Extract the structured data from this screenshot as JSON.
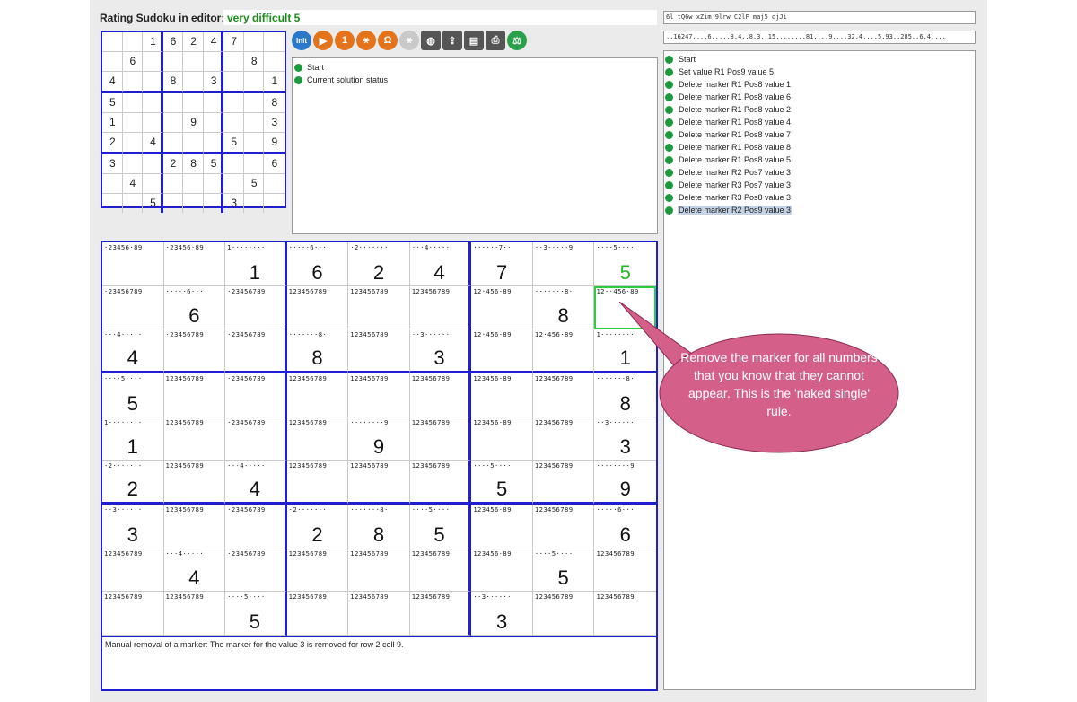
{
  "header": {
    "rating_label": "Rating Sudoku in editor:",
    "rating_value": "very difficult 5",
    "code_line1": "6l tQ6w xZim 9lrw C2lF maj5 qjJi",
    "code_line2": "..16247....6.....8.4..8.3..15........81....9....32.4....5.93..285..6.4...."
  },
  "small_grid": {
    "cells": [
      "",
      "",
      "1",
      "6",
      "2",
      "4",
      "7",
      "",
      "",
      "",
      "6",
      "",
      "",
      "",
      "",
      "",
      "8",
      "",
      "4",
      "",
      "",
      "8",
      "",
      "3",
      "",
      "",
      "1",
      "5",
      "",
      "",
      "",
      "",
      "",
      "",
      "",
      "8",
      "1",
      "",
      "",
      "",
      "9",
      "",
      "",
      "",
      "3",
      "2",
      "",
      "4",
      "",
      "",
      "",
      "5",
      "",
      "9",
      "3",
      "",
      "",
      "2",
      "8",
      "5",
      "",
      "",
      "6",
      "",
      "4",
      "",
      "",
      "",
      "",
      "",
      "5",
      "",
      "",
      "",
      "5",
      "",
      "",
      "",
      "3",
      "",
      ""
    ]
  },
  "toolbar": {
    "buttons": [
      {
        "name": "init-button",
        "label": "Init",
        "style": "init"
      },
      {
        "name": "play-icon",
        "label": "▶",
        "style": "orange"
      },
      {
        "name": "step-one-icon",
        "label": "1",
        "style": "orange"
      },
      {
        "name": "walk-icon",
        "label": "⚹",
        "style": "orange"
      },
      {
        "name": "omega-icon",
        "label": "Ω",
        "style": "orange"
      },
      {
        "name": "runner-disabled-icon",
        "label": "⚹",
        "style": "gray"
      },
      {
        "name": "globe-icon",
        "label": "◍",
        "style": "dark"
      },
      {
        "name": "export-icon",
        "label": "⇪",
        "style": "dark"
      },
      {
        "name": "save-icon",
        "label": "▤",
        "style": "dark"
      },
      {
        "name": "print-icon",
        "label": "⎙",
        "style": "dark"
      },
      {
        "name": "balance-icon",
        "label": "⚖",
        "style": "green"
      }
    ]
  },
  "status": {
    "items": [
      "Start",
      "Current solution status"
    ]
  },
  "history": {
    "items": [
      "Start",
      "Set value R1 Pos9 value 5",
      "Delete marker R1 Pos8 value 1",
      "Delete marker R1 Pos8 value 6",
      "Delete marker R1 Pos8 value 2",
      "Delete marker R1 Pos8 value 4",
      "Delete marker R1 Pos8 value 7",
      "Delete marker R1 Pos8 value 8",
      "Delete marker R1 Pos8 value 5",
      "Delete marker R2 Pos7 value 3",
      "Delete marker R3 Pos7 value 3",
      "Delete marker R3 Pos8 value 3",
      "Delete marker R2 Pos9 value 3"
    ],
    "selected_index": 12
  },
  "big_grid": {
    "cells": [
      {
        "m": "·23456·89",
        "v": ""
      },
      {
        "m": "·23456·89",
        "v": ""
      },
      {
        "m": "1········",
        "v": "1"
      },
      {
        "m": "·····6···",
        "v": "6"
      },
      {
        "m": "·2·······",
        "v": "2"
      },
      {
        "m": "···4·····",
        "v": "4"
      },
      {
        "m": "······7··",
        "v": "7"
      },
      {
        "m": "··3·····9",
        "v": ""
      },
      {
        "m": "····5····",
        "v": "5",
        "green": true
      },
      {
        "m": "·23456789",
        "v": ""
      },
      {
        "m": "·····6···",
        "v": "6"
      },
      {
        "m": "·23456789",
        "v": ""
      },
      {
        "m": "123456789",
        "v": ""
      },
      {
        "m": "123456789",
        "v": ""
      },
      {
        "m": "123456789",
        "v": ""
      },
      {
        "m": "12·456·89",
        "v": ""
      },
      {
        "m": "·······8·",
        "v": "8"
      },
      {
        "m": "12··456·89",
        "v": "",
        "sel": true
      },
      {
        "m": "···4·····",
        "v": "4"
      },
      {
        "m": "·23456789",
        "v": ""
      },
      {
        "m": "·23456789",
        "v": ""
      },
      {
        "m": "·······8·",
        "v": "8"
      },
      {
        "m": "123456789",
        "v": ""
      },
      {
        "m": "··3······",
        "v": "3"
      },
      {
        "m": "12·456·89",
        "v": ""
      },
      {
        "m": "12·456·89",
        "v": ""
      },
      {
        "m": "1········",
        "v": "1"
      },
      {
        "m": "····5····",
        "v": "5"
      },
      {
        "m": "123456789",
        "v": ""
      },
      {
        "m": "·23456789",
        "v": ""
      },
      {
        "m": "123456789",
        "v": ""
      },
      {
        "m": "123456789",
        "v": ""
      },
      {
        "m": "123456789",
        "v": ""
      },
      {
        "m": "123456·89",
        "v": ""
      },
      {
        "m": "123456789",
        "v": ""
      },
      {
        "m": "·······8·",
        "v": "8"
      },
      {
        "m": "1········",
        "v": "1"
      },
      {
        "m": "123456789",
        "v": ""
      },
      {
        "m": "·23456789",
        "v": ""
      },
      {
        "m": "123456789",
        "v": ""
      },
      {
        "m": "········9",
        "v": "9"
      },
      {
        "m": "123456789",
        "v": ""
      },
      {
        "m": "123456·89",
        "v": ""
      },
      {
        "m": "123456789",
        "v": ""
      },
      {
        "m": "··3······",
        "v": "3"
      },
      {
        "m": "·2·······",
        "v": "2"
      },
      {
        "m": "123456789",
        "v": ""
      },
      {
        "m": "···4·····",
        "v": "4"
      },
      {
        "m": "123456789",
        "v": ""
      },
      {
        "m": "123456789",
        "v": ""
      },
      {
        "m": "123456789",
        "v": ""
      },
      {
        "m": "····5····",
        "v": "5"
      },
      {
        "m": "123456789",
        "v": ""
      },
      {
        "m": "········9",
        "v": "9"
      },
      {
        "m": "··3······",
        "v": "3"
      },
      {
        "m": "123456789",
        "v": ""
      },
      {
        "m": "·23456789",
        "v": ""
      },
      {
        "m": "·2·······",
        "v": "2"
      },
      {
        "m": "·······8·",
        "v": "8"
      },
      {
        "m": "····5····",
        "v": "5"
      },
      {
        "m": "123456·89",
        "v": ""
      },
      {
        "m": "123456789",
        "v": ""
      },
      {
        "m": "·····6···",
        "v": "6"
      },
      {
        "m": "123456789",
        "v": ""
      },
      {
        "m": "···4·····",
        "v": "4"
      },
      {
        "m": "·23456789",
        "v": ""
      },
      {
        "m": "123456789",
        "v": ""
      },
      {
        "m": "123456789",
        "v": ""
      },
      {
        "m": "123456789",
        "v": ""
      },
      {
        "m": "123456·89",
        "v": ""
      },
      {
        "m": "····5····",
        "v": "5"
      },
      {
        "m": "123456789",
        "v": ""
      },
      {
        "m": "123456789",
        "v": ""
      },
      {
        "m": "123456789",
        "v": ""
      },
      {
        "m": "····5····",
        "v": "5"
      },
      {
        "m": "123456789",
        "v": ""
      },
      {
        "m": "123456789",
        "v": ""
      },
      {
        "m": "123456789",
        "v": ""
      },
      {
        "m": "··3······",
        "v": "3"
      },
      {
        "m": "123456789",
        "v": ""
      },
      {
        "m": "123456789",
        "v": ""
      }
    ]
  },
  "message": "Manual removal of a marker: The marker for the value 3 is removed for row 2 cell 9.",
  "callout": {
    "text": "Remove the marker for all numbers that you know that they cannot appear. This is the 'naked single' rule.",
    "color": "#d4608a"
  }
}
